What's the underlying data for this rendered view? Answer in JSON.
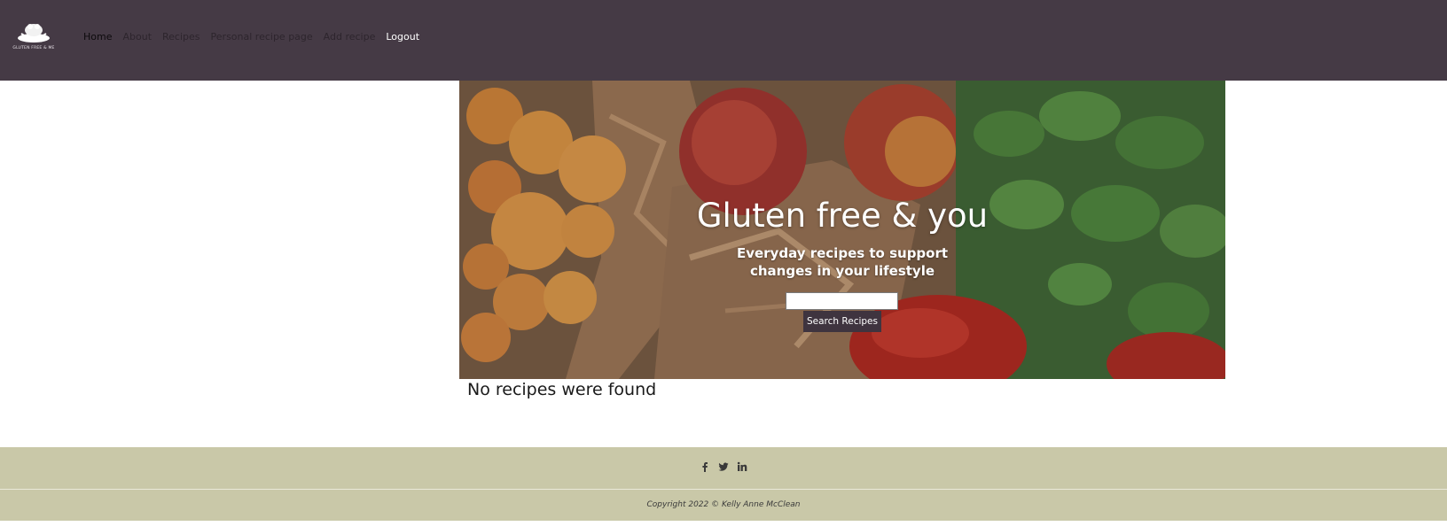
{
  "nav": {
    "logo_text": "GLUTEN FREE & ME",
    "links": [
      "Home",
      "About",
      "Recipes",
      "Personal recipe page",
      "Add recipe",
      "Logout"
    ]
  },
  "hero": {
    "title": "Gluten free & you",
    "subtitle": "Everyday recipes to support changes in your lifestyle",
    "search_value": "",
    "search_button": "Search Recipes"
  },
  "results": {
    "message": "No recipes were found"
  },
  "footer": {
    "social_icons": [
      "facebook-icon",
      "twitter-icon",
      "linkedin-icon"
    ],
    "copyright": "Copyright 2022 © Kelly Anne McClean"
  },
  "colors": {
    "navbar": "#453a45",
    "footer": "#c9c8a8",
    "button": "#3f343f"
  }
}
